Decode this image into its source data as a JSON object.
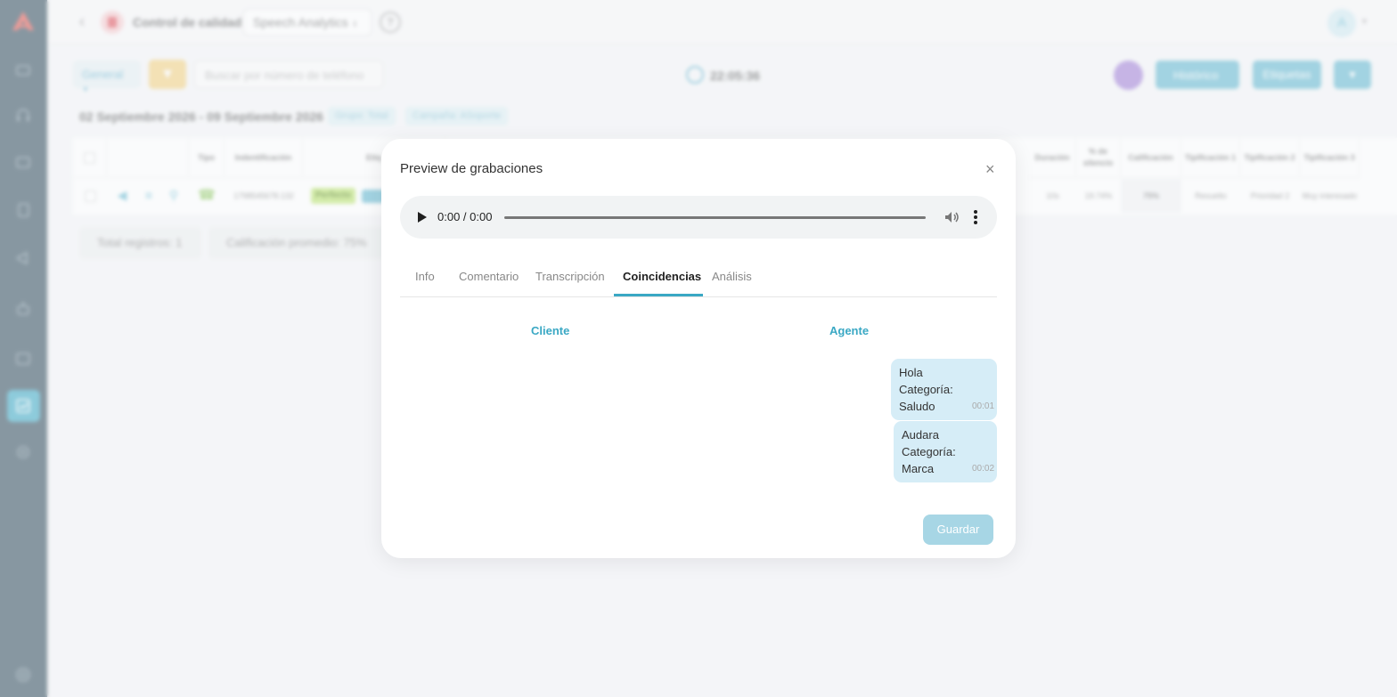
{
  "header": {
    "title": "Control de calidad",
    "module": "Speech Analytics",
    "help": "?",
    "avatar_initial": "A"
  },
  "toolbar": {
    "general_label": "General",
    "search_placeholder": "Buscar por número de teléfono",
    "clock": "22:05:36",
    "historico_label": "Histórico",
    "etiquetas_label": "Etiquetas"
  },
  "filters": {
    "date_range": "02 Septiembre 2026 - 09 Septiembre 2026",
    "group_chip": "Grupo: Total",
    "campaign_chip": "Campaña: ASoporte"
  },
  "table": {
    "headers": {
      "tipo": "Tipo",
      "identificacion": "Indentificación",
      "etiquetas": "Etiq",
      "duracion": "Duración",
      "silencio": "% de silencio",
      "calificacion": "Calificación",
      "tip1": "Tipificación 1",
      "tip2": "Tipificación 2",
      "tip3": "Tipificación 3"
    },
    "row": {
      "identificacion": "1798545678.132",
      "tag": "Perfecto",
      "duracion": "10s",
      "silencio": "19.74%",
      "calificacion": "75%",
      "tip1": "Resuelto",
      "tip2": "Prioridad 2",
      "tip3": "Muy interesado"
    }
  },
  "summary": {
    "total": "Total registros: 1",
    "average": "Calificación promedio: 75%"
  },
  "modal": {
    "title": "Preview de grabaciones",
    "audio_time": "0:00 / 0:00",
    "tabs": [
      {
        "label": "Info"
      },
      {
        "label": "Comentario"
      },
      {
        "label": "Transcripción"
      },
      {
        "label": "Coincidencias"
      },
      {
        "label": "Análisis"
      }
    ],
    "active_tab": "Coincidencias",
    "col_cliente": "Cliente",
    "col_agente": "Agente",
    "matches": [
      {
        "word": "Hola",
        "category": "Categoría: Saludo",
        "time": "00:01"
      },
      {
        "word": "Audara",
        "category": "Categoría: Marca",
        "time": "00:02"
      }
    ],
    "save_label": "Guardar"
  },
  "colors": {
    "accent": "#3aa8c4",
    "sidebar": "#2f4a5a",
    "bubble": "#d6edf7"
  }
}
